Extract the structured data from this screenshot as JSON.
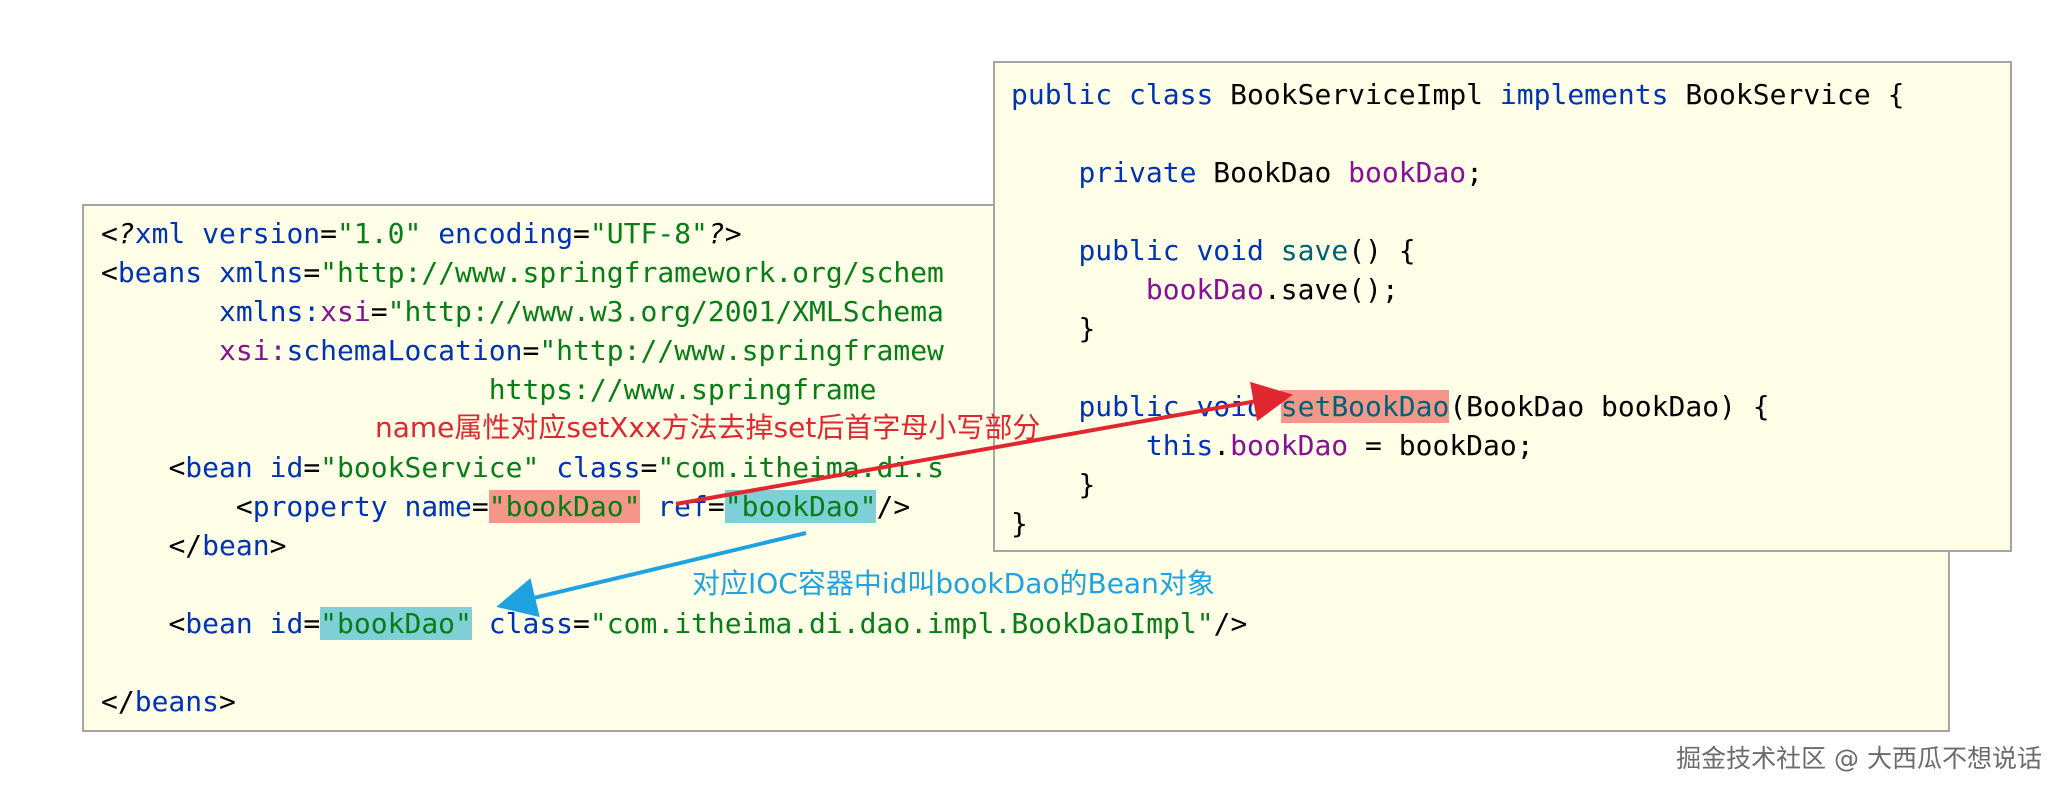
{
  "xml_code": {
    "line1": {
      "a": "<",
      "b": "?",
      "c": "xml ",
      "d": "version",
      "e": "=",
      "f": "\"1.0\"",
      "g": " ",
      "h": "encoding",
      "i": "=",
      "j": "\"UTF-8\"",
      "k": "?",
      "l": ">"
    },
    "line2": {
      "a": "<",
      "b": "beans ",
      "c": "xmlns",
      "d": "=",
      "e": "\"http://www.springframework.org/schem"
    },
    "line3": {
      "indent": "       ",
      "a": "xmlns:",
      "b": "xsi",
      "c": "=",
      "d": "\"http://www.w3.org/2001/XMLSchema"
    },
    "line4": {
      "indent": "       ",
      "a": "xsi:",
      "b": "schemaLocation",
      "c": "=",
      "d": "\"http://www.springframew"
    },
    "line5": {
      "indent": "                       ",
      "a": "https://www.springframe"
    },
    "line7": {
      "indent": "    ",
      "a": "<",
      "b": "bean ",
      "c": "id",
      "d": "=",
      "e": "\"bookService\"",
      "f": " ",
      "g": "class",
      "h": "=",
      "i": "\"com.itheima.di.s"
    },
    "line8": {
      "indent": "        ",
      "a": "<",
      "b": "property ",
      "c": "name",
      "d": "=",
      "e": "\"bookDao\"",
      "f": " ",
      "g": "ref",
      "h": "=",
      "i": "\"bookDao\"",
      "j": "/>"
    },
    "line9": {
      "indent": "    ",
      "a": "</",
      "b": "bean",
      "c": ">"
    },
    "line11": {
      "indent": "    ",
      "a": "<",
      "b": "bean ",
      "c": "id",
      "d": "=",
      "e": "\"bookDao\"",
      "f": " ",
      "g": "class",
      "h": "=",
      "i": "\"com.itheima.di.dao.impl.BookDaoImpl\"",
      "j": "/>"
    },
    "line13": {
      "a": "</",
      "b": "beans",
      "c": ">"
    }
  },
  "java_code": {
    "line1": {
      "a": "public ",
      "b": "class ",
      "c": "BookServiceImpl ",
      "d": "implements ",
      "e": "BookService {"
    },
    "line3": {
      "indent": "    ",
      "a": "private ",
      "b": "BookDao ",
      "c": "bookDao",
      "d": ";"
    },
    "line5": {
      "indent": "    ",
      "a": "public ",
      "b": "void ",
      "c": "save",
      "d": "() {"
    },
    "line6": {
      "indent": "        ",
      "a": "bookDao",
      "b": ".save();"
    },
    "line7": {
      "indent": "    ",
      "a": "}"
    },
    "line9": {
      "indent": "    ",
      "a": "public ",
      "b": "void ",
      "c": "setBookDao",
      "d": "(BookDao bookDao) {"
    },
    "line10": {
      "indent": "        ",
      "a": "this",
      ".": ".",
      "b": "bookDao",
      "c": " = bookDao;"
    },
    "line11": {
      "indent": "    ",
      "a": "}"
    },
    "line12": {
      "a": "}"
    }
  },
  "annotations": {
    "name_note": "name属性对应setXxx方法去掉set后首字母小写部分",
    "ref_note": "对应IOC容器中id叫bookDao的Bean对象"
  },
  "watermark": "掘金技术社区 @ 大西瓜不想说话",
  "colors": {
    "highlight_red": "#f4968a",
    "highlight_teal": "#7ecfd6",
    "annotation_red": "#e0262f",
    "annotation_blue": "#1ea3e0",
    "panel_bg": "#ffffe8"
  }
}
